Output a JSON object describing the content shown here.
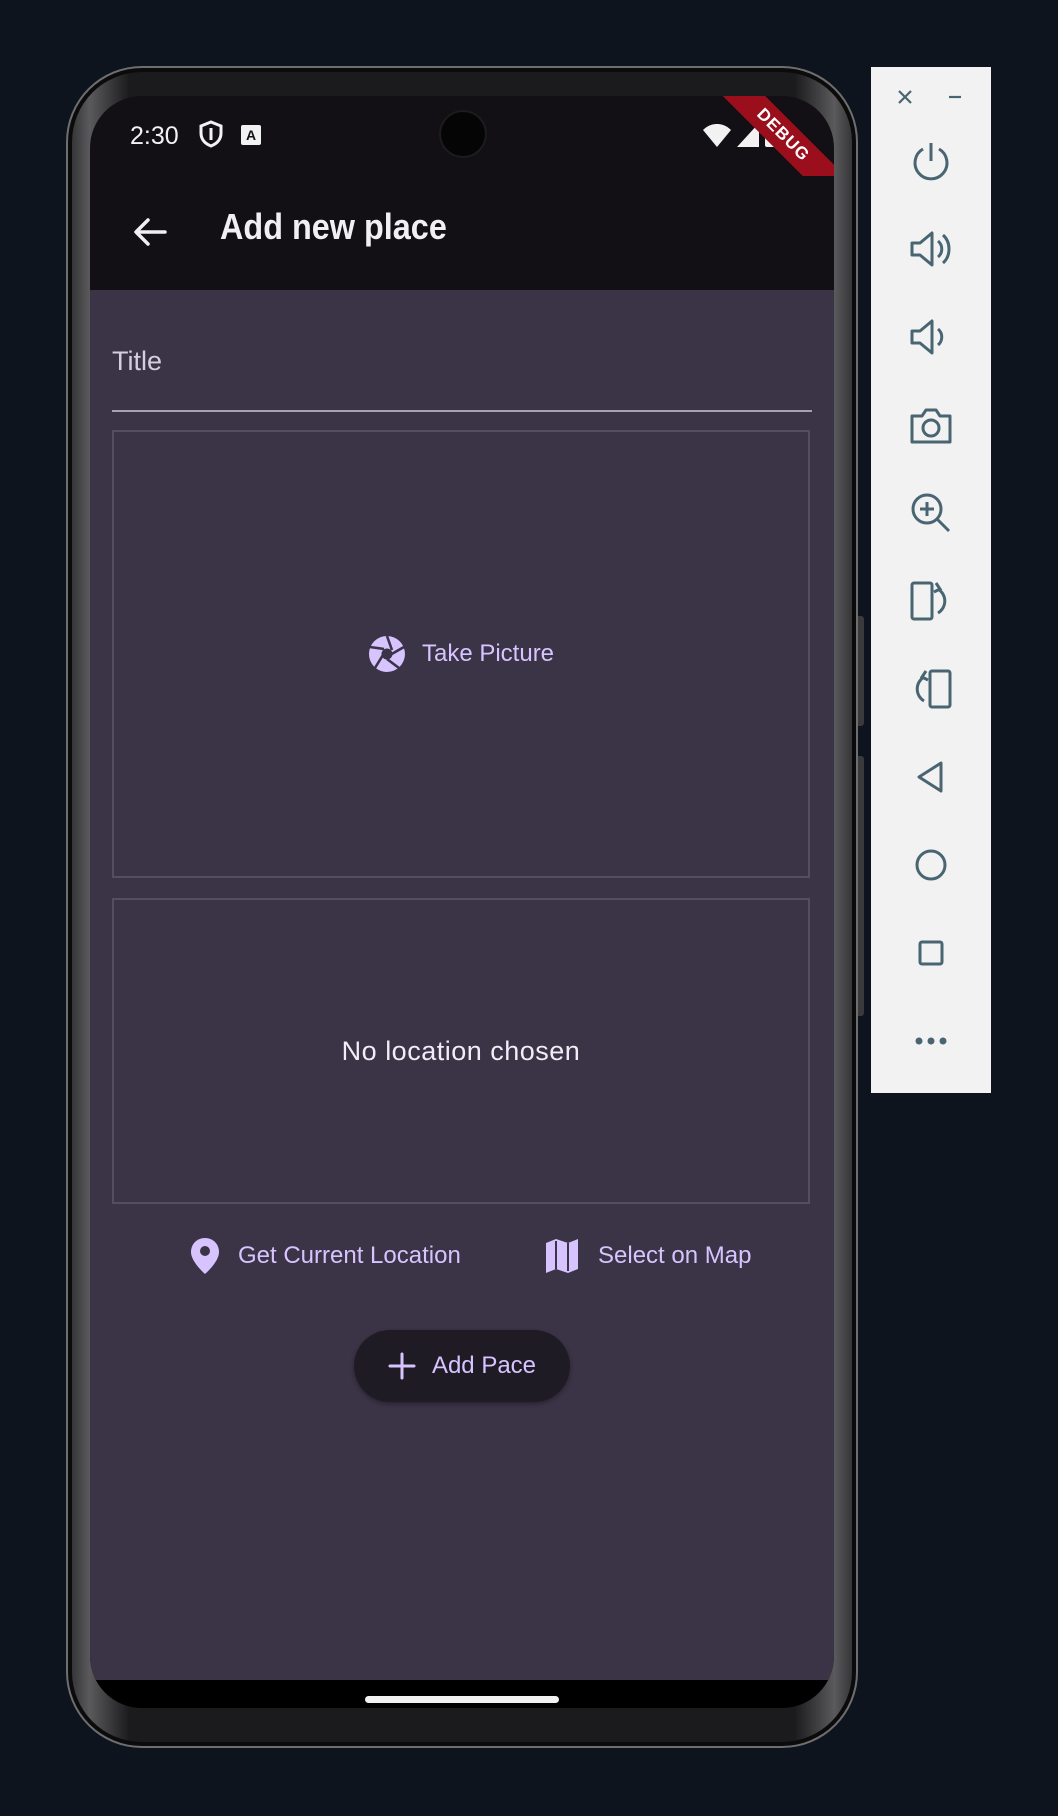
{
  "status_bar": {
    "time": "2:30",
    "icons": [
      "shield-icon",
      "keyboard-a-icon",
      "wifi-icon",
      "signal-icon",
      "battery-icon"
    ]
  },
  "debug_banner": "DEBUG",
  "app_bar": {
    "title": "Add new place",
    "back_icon": "arrow-back-icon"
  },
  "form": {
    "title_label": "Title",
    "take_picture_label": "Take Picture",
    "no_location_text": "No location chosen",
    "get_location_label": "Get Current Location",
    "select_map_label": "Select on Map",
    "add_button_label": "Add Pace"
  },
  "colors": {
    "background": "#3b3346",
    "accent": "#d7c4ff",
    "app_bar": "#121014",
    "button_bg": "#1f1b24",
    "debug": "#9b0f1c"
  },
  "emulator_toolbar": {
    "items": [
      "close-icon",
      "minimize-icon",
      "power-icon",
      "volume-up-icon",
      "volume-down-icon",
      "camera-icon",
      "zoom-icon",
      "rotate-left-icon",
      "rotate-right-icon",
      "back-icon",
      "home-icon",
      "overview-icon",
      "more-icon"
    ]
  }
}
